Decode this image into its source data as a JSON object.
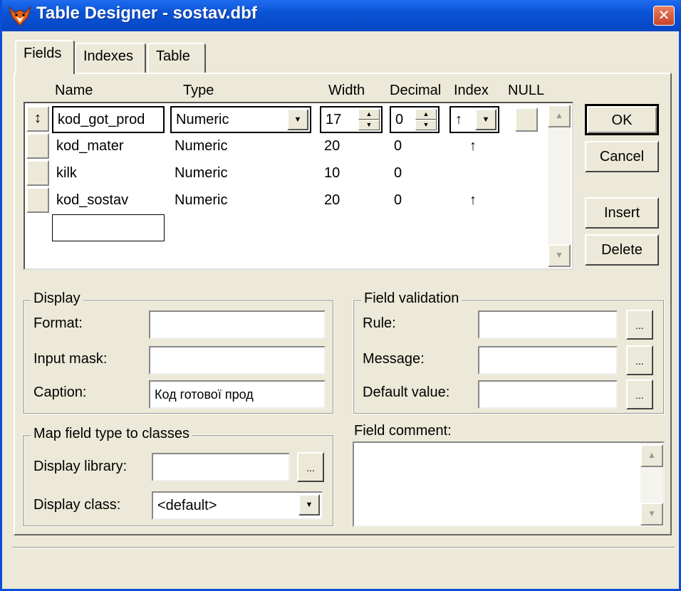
{
  "window": {
    "title": "Table Designer - sostav.dbf",
    "close_label": "✕"
  },
  "tabs": [
    {
      "label": "Fields"
    },
    {
      "label": "Indexes"
    },
    {
      "label": "Table"
    }
  ],
  "grid": {
    "columns": [
      "Name",
      "Type",
      "Width",
      "Decimal",
      "Index",
      "NULL"
    ],
    "rows": [
      {
        "name": "kod_got_prod",
        "type": "Numeric",
        "width": "17",
        "decimal": "0",
        "index": "↑",
        "selector": "↕"
      },
      {
        "name": "kod_mater",
        "type": "Numeric",
        "width": "20",
        "decimal": "0",
        "index": "↑",
        "selector": ""
      },
      {
        "name": "kilk",
        "type": "Numeric",
        "width": "10",
        "decimal": "0",
        "index": "",
        "selector": ""
      },
      {
        "name": "kod_sostav",
        "type": "Numeric",
        "width": "20",
        "decimal": "0",
        "index": "↑",
        "selector": ""
      }
    ],
    "new_row_name": ""
  },
  "buttons": {
    "ok": "OK",
    "cancel": "Cancel",
    "insert": "Insert",
    "delete": "Delete"
  },
  "display": {
    "title": "Display",
    "format_label": "Format:",
    "format_value": "",
    "input_mask_label": "Input mask:",
    "input_mask_value": "",
    "caption_label": "Caption:",
    "caption_value": "Код готової прод"
  },
  "validation": {
    "title": "Field validation",
    "rule_label": "Rule:",
    "rule_value": "",
    "message_label": "Message:",
    "message_value": "",
    "default_label": "Default value:",
    "default_value": ""
  },
  "map": {
    "title": "Map field type to classes",
    "library_label": "Display library:",
    "library_value": "",
    "class_label": "Display class:",
    "class_value": "<default>"
  },
  "comment": {
    "label": "Field comment:",
    "value": ""
  },
  "ellipsis_label": "...",
  "icons": {
    "app": "foxpro-fox-icon",
    "dropdown": "▼",
    "spin_up": "▲",
    "spin_down": "▼",
    "scroll_up": "▲",
    "scroll_down": "▼"
  }
}
